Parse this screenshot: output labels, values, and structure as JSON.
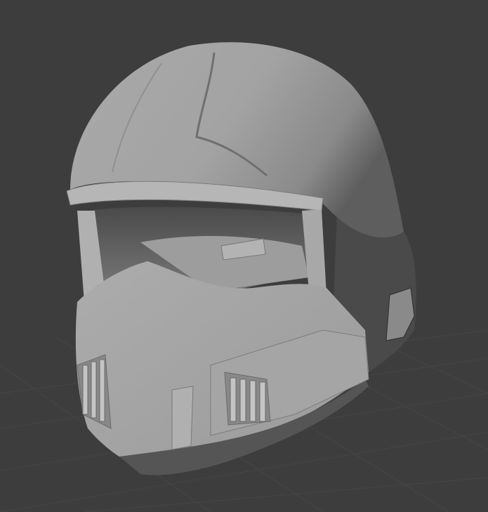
{
  "viewport": {
    "name": "3D viewport",
    "object": "helmet-model",
    "colors": {
      "background": "#3d3d3d",
      "grid": "#474747",
      "model_light": "#b4b4b4",
      "model_mid": "#9a9a9a",
      "model_dark": "#5a5a5a",
      "model_shadow": "#3a3a3a"
    }
  }
}
